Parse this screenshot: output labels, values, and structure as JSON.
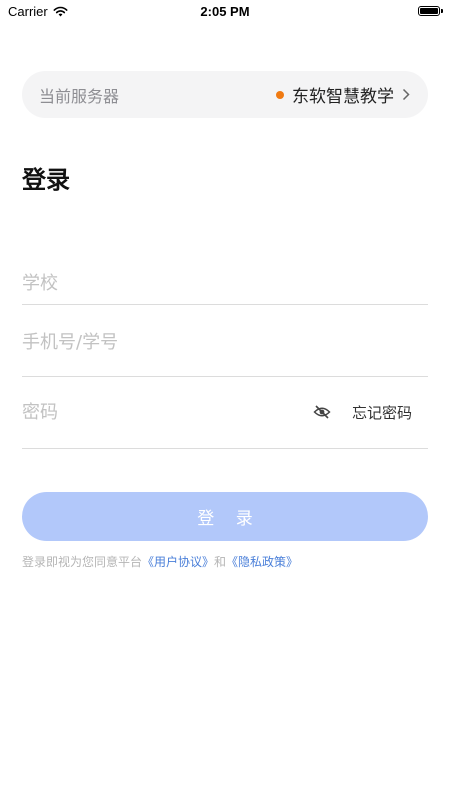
{
  "status_bar": {
    "carrier": "Carrier",
    "time": "2:05 PM",
    "wifi_icon": "wifi-icon",
    "battery_icon": "battery-icon"
  },
  "server": {
    "label": "当前服务器",
    "name": "东软智慧教学",
    "dot_color": "#f07a12",
    "chevron_icon": "chevron-right-icon"
  },
  "login_title": "登录",
  "form": {
    "school_placeholder": "学校",
    "school_value": "",
    "account_placeholder": "手机号/学号",
    "account_value": "",
    "password_placeholder": "密码",
    "password_value": "",
    "eye_icon": "eye-slash-icon",
    "forgot_password": "忘记密码"
  },
  "login_button": {
    "label": "登 录",
    "color": "#b2c8fa"
  },
  "agreement": {
    "prefix": "登录即视为您同意平台",
    "user_agreement": "《用户协议》",
    "conjunction": "和",
    "privacy_policy": "《隐私政策》",
    "link_color": "#4a7fd9"
  }
}
